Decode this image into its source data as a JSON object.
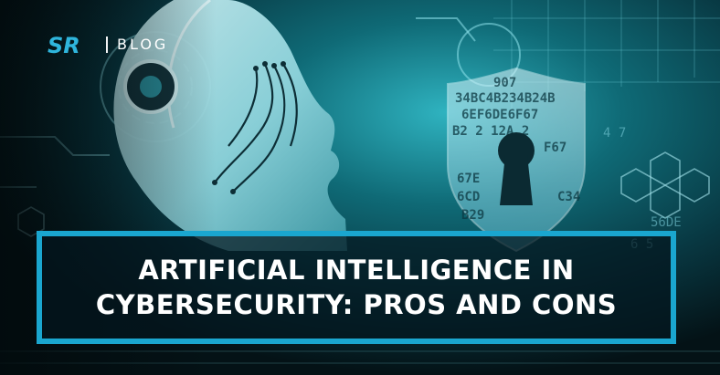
{
  "brand": {
    "logo_text": "SR",
    "label": "BLOG"
  },
  "headline": {
    "line1": "ARTIFICIAL INTELLIGENCE IN",
    "line2": "CYBERSECURITY: PROS AND CONS"
  },
  "colors": {
    "accent": "#1aa6cf",
    "background_dark": "#061318",
    "background_teal": "#0b4a56",
    "text": "#ffffff"
  },
  "icons": {
    "shield": "padlock-shield-icon",
    "robot": "robot-head"
  }
}
